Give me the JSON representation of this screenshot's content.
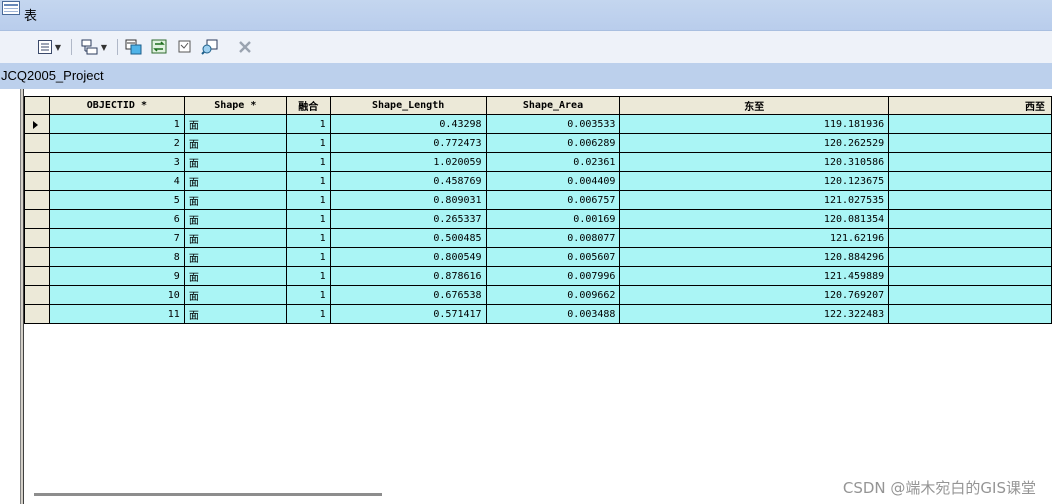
{
  "window": {
    "title": "表"
  },
  "toolbar": {
    "buttons": [
      {
        "icon": "table-options-icon",
        "has_dropdown": true
      },
      {
        "icon": "related-tables-icon",
        "has_dropdown": true
      },
      {
        "icon": "select-by-attributes-icon"
      },
      {
        "icon": "switch-selection-icon"
      },
      {
        "icon": "clear-selection-icon"
      },
      {
        "icon": "zoom-to-selected-icon"
      },
      {
        "icon": "delete-selected-icon"
      }
    ]
  },
  "layer": {
    "name": "JCQ2005_Project"
  },
  "table": {
    "columns": [
      "OBJECTID *",
      "Shape *",
      "融合",
      "Shape_Length",
      "Shape_Area",
      "东至",
      "西至"
    ],
    "rows": [
      [
        "1",
        "面",
        "1",
        "0.43298",
        "0.003533",
        "119.181936",
        ""
      ],
      [
        "2",
        "面",
        "1",
        "0.772473",
        "0.006289",
        "120.262529",
        ""
      ],
      [
        "3",
        "面",
        "1",
        "1.020059",
        "0.02361",
        "120.310586",
        ""
      ],
      [
        "4",
        "面",
        "1",
        "0.458769",
        "0.004409",
        "120.123675",
        ""
      ],
      [
        "5",
        "面",
        "1",
        "0.809031",
        "0.006757",
        "121.027535",
        ""
      ],
      [
        "6",
        "面",
        "1",
        "0.265337",
        "0.00169",
        "120.081354",
        ""
      ],
      [
        "7",
        "面",
        "1",
        "0.500485",
        "0.008077",
        "121.62196",
        ""
      ],
      [
        "8",
        "面",
        "1",
        "0.800549",
        "0.005607",
        "120.884296",
        ""
      ],
      [
        "9",
        "面",
        "1",
        "0.878616",
        "0.007996",
        "121.459889",
        ""
      ],
      [
        "10",
        "面",
        "1",
        "0.676538",
        "0.009662",
        "120.769207",
        ""
      ],
      [
        "11",
        "面",
        "1",
        "0.571417",
        "0.003488",
        "122.322483",
        ""
      ]
    ],
    "current_row": 0,
    "cell_color": "#aaf5f5"
  },
  "watermark": "CSDN @端木宛白的GIS课堂"
}
